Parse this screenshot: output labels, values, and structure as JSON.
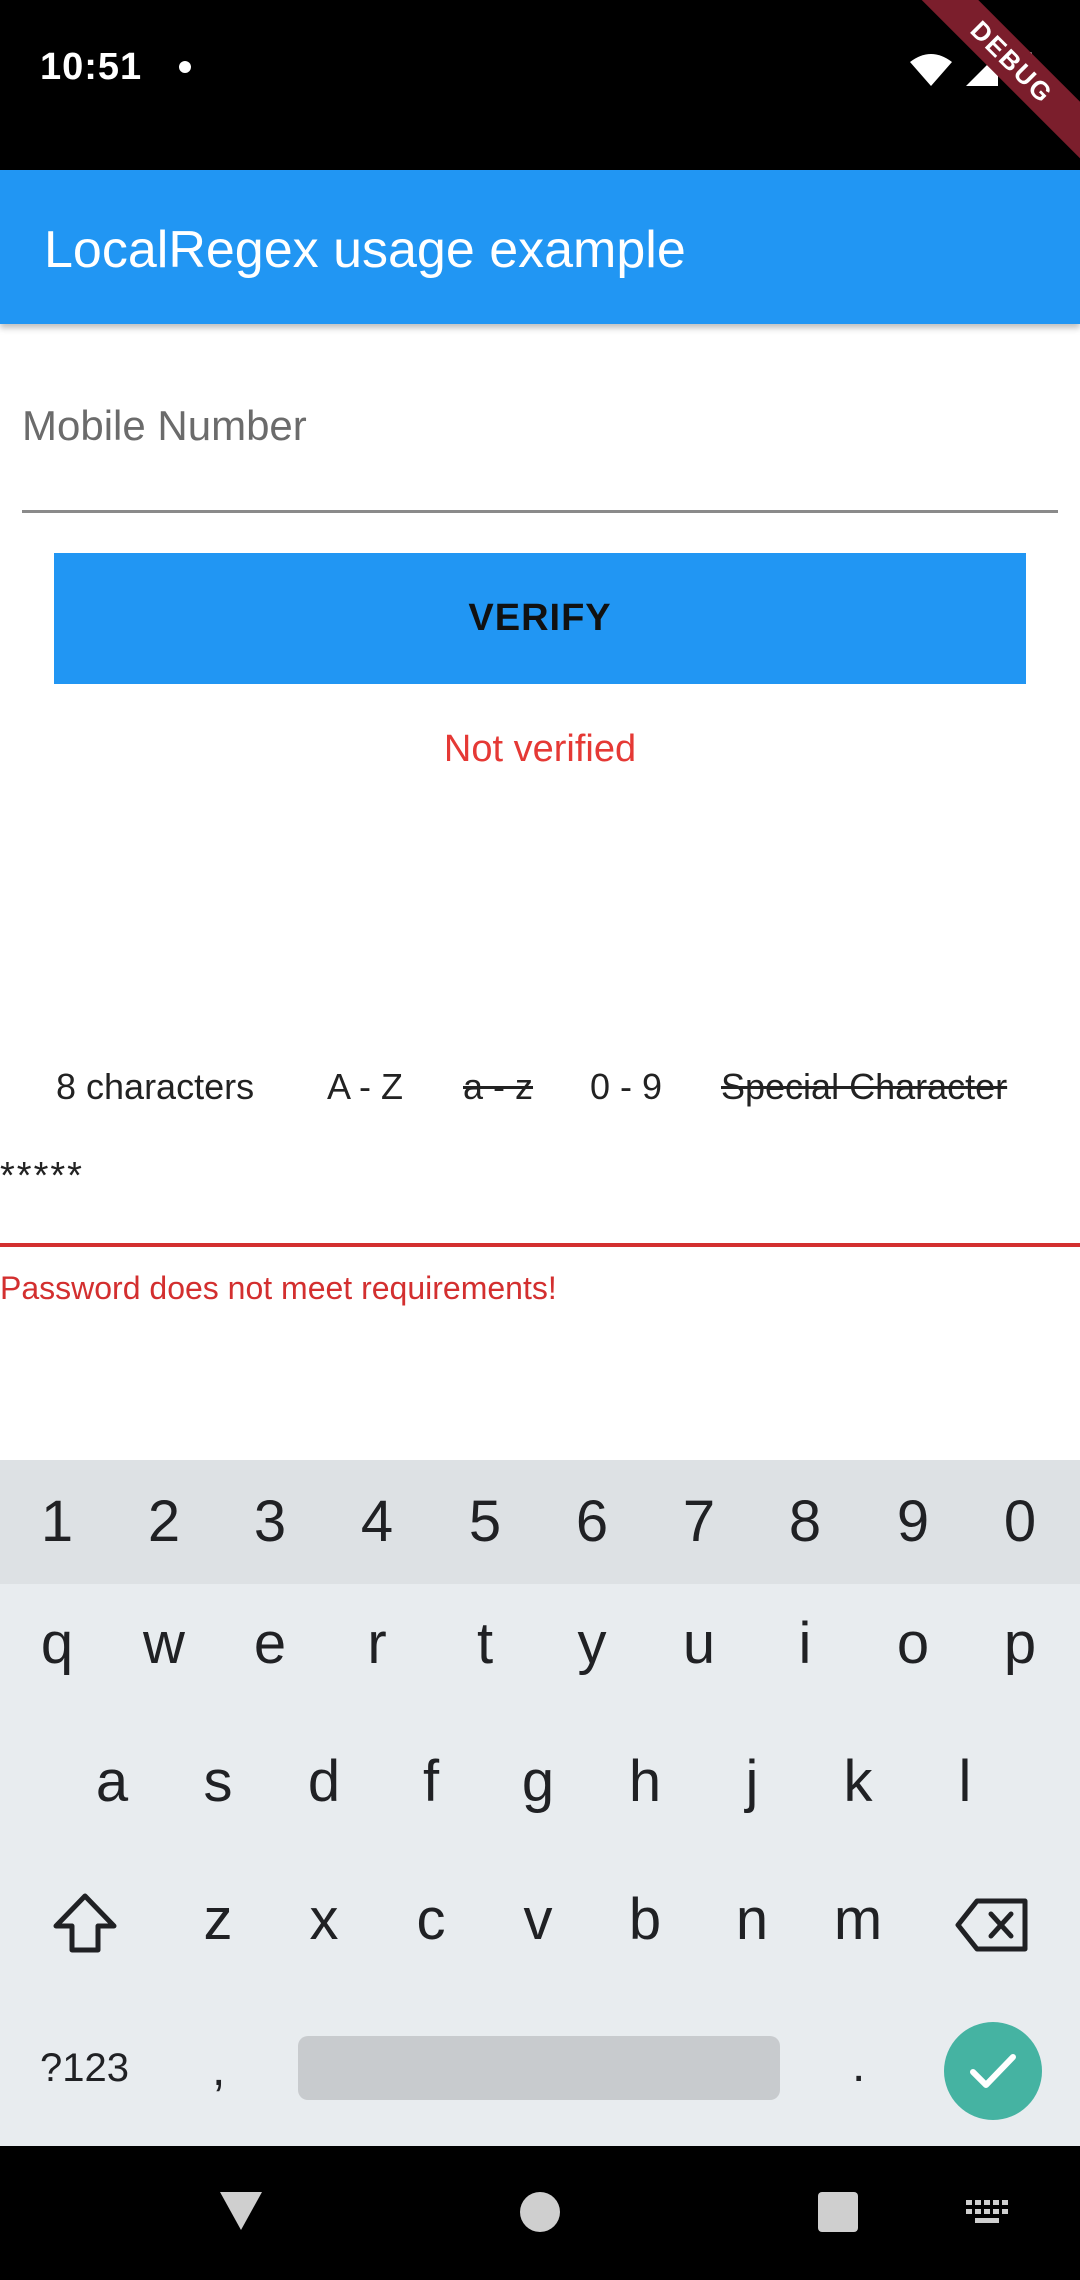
{
  "status_bar": {
    "time": "10:51",
    "debug_label": "DEBUG"
  },
  "app_bar": {
    "title": "LocalRegex usage example"
  },
  "mobile_field": {
    "label": "Mobile Number"
  },
  "verify_button": {
    "label": "VERIFY"
  },
  "verification_status": {
    "text": "Not verified",
    "color": "#e53935"
  },
  "requirements": [
    {
      "label": "8 characters",
      "struck": false
    },
    {
      "label": "A - Z",
      "struck": false
    },
    {
      "label": "a - z",
      "struck": true
    },
    {
      "label": "0 - 9",
      "struck": false
    },
    {
      "label": "Special Character",
      "struck": true
    }
  ],
  "password_field": {
    "value": "*****",
    "error": "Password does not meet requirements!"
  },
  "keyboard": {
    "number_row": [
      "1",
      "2",
      "3",
      "4",
      "5",
      "6",
      "7",
      "8",
      "9",
      "0"
    ],
    "row1": [
      "q",
      "w",
      "e",
      "r",
      "t",
      "y",
      "u",
      "i",
      "o",
      "p"
    ],
    "row2": [
      "a",
      "s",
      "d",
      "f",
      "g",
      "h",
      "j",
      "k",
      "l"
    ],
    "row3": [
      "z",
      "x",
      "c",
      "v",
      "b",
      "n",
      "m"
    ],
    "symbols_key": "?123",
    "comma_key": ",",
    "period_key": "."
  },
  "colors": {
    "primary": "#2196f3",
    "error": "#d32f2f",
    "enter_key": "#45b3a2"
  }
}
